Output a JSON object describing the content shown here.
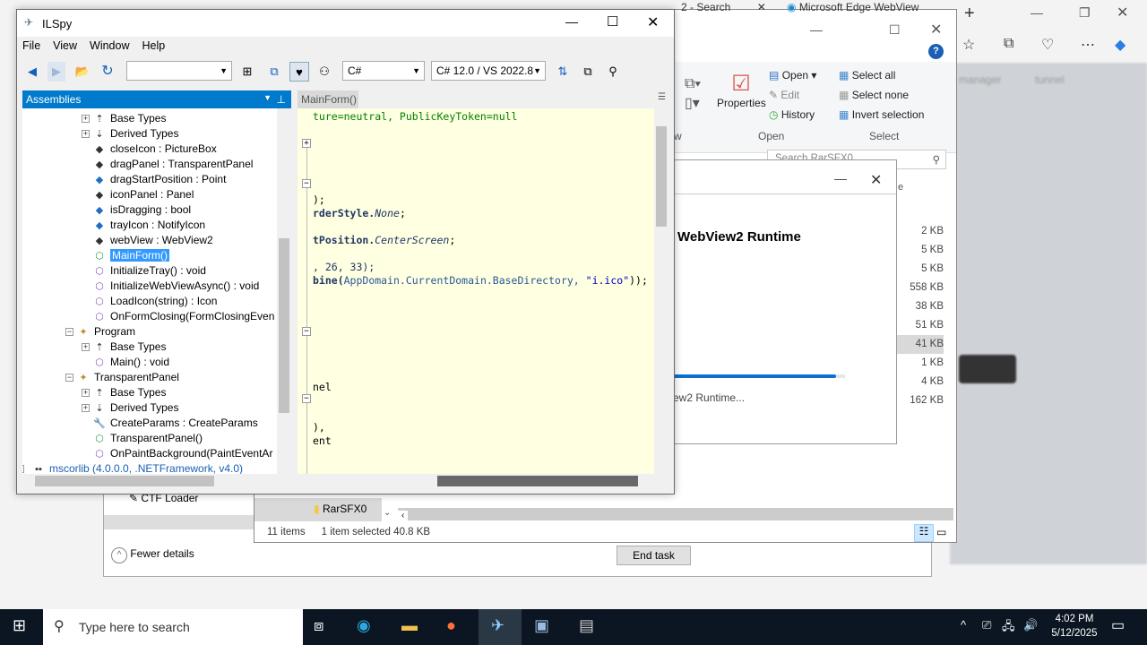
{
  "edge": {
    "tabs": [
      "2 - Search",
      "Microsoft Edge WebView"
    ],
    "new_tab": "+",
    "blurred": [
      "manager",
      "tunnel"
    ]
  },
  "explorer": {
    "ribbon": {
      "properties": "Properties",
      "open": "Open",
      "edit": "Edit",
      "history": "History",
      "select_all": "Select all",
      "select_none": "Select none",
      "invert_selection": "Invert selection",
      "group_view": "w",
      "group_open": "Open",
      "group_select": "Select"
    },
    "search_placeholder": "Search RarSFX0",
    "size_header": "e",
    "sizes": [
      "2 KB",
      "5 KB",
      "5 KB",
      "558 KB",
      "38 KB",
      "51 KB",
      "41 KB",
      "1 KB",
      "4 KB",
      "162 KB"
    ],
    "nav_folder": "RarSFX0",
    "status": {
      "items": "11 items",
      "selected": "1 item selected",
      "size": "40.8 KB"
    }
  },
  "task_manager": {
    "process": "CTF Loader",
    "fewer_details": "Fewer details",
    "end_task": "End task"
  },
  "installer": {
    "title": "WebView2 Runtime",
    "status": "ew2 Runtime...",
    "progress": 0.95
  },
  "ilspy": {
    "title": "ILSpy",
    "menu": [
      "File",
      "View",
      "Window",
      "Help"
    ],
    "language": "C#",
    "version": "C# 12.0 / VS 2022.8",
    "search_combo": "",
    "assemblies_label": "Assemblies",
    "tab": "MainForm()",
    "tree": [
      {
        "label": "Base Types",
        "icon": "base-types"
      },
      {
        "label": "Derived Types",
        "icon": "derived-types"
      },
      {
        "label": "closeIcon : PictureBox",
        "icon": "field"
      },
      {
        "label": "dragPanel : TransparentPanel",
        "icon": "field"
      },
      {
        "label": "dragStartPosition : Point",
        "icon": "field-struct"
      },
      {
        "label": "iconPanel : Panel",
        "icon": "field"
      },
      {
        "label": "isDragging : bool",
        "icon": "field-struct"
      },
      {
        "label": "trayIcon : NotifyIcon",
        "icon": "field-struct"
      },
      {
        "label": "webView : WebView2",
        "icon": "field"
      },
      {
        "label": "MainForm()",
        "icon": "constructor"
      },
      {
        "label": "InitializeTray() : void",
        "icon": "method"
      },
      {
        "label": "InitializeWebViewAsync() : void",
        "icon": "method"
      },
      {
        "label": "LoadIcon(string) : Icon",
        "icon": "method"
      },
      {
        "label": "OnFormClosing(FormClosingEven",
        "icon": "method"
      },
      {
        "label": "Program",
        "icon": "class"
      },
      {
        "label": "Base Types",
        "icon": "base-types"
      },
      {
        "label": "Main() : void",
        "icon": "method"
      },
      {
        "label": "TransparentPanel",
        "icon": "class"
      },
      {
        "label": "Base Types",
        "icon": "base-types"
      },
      {
        "label": "Derived Types",
        "icon": "derived-types"
      },
      {
        "label": "CreateParams : CreateParams",
        "icon": "property"
      },
      {
        "label": "TransparentPanel()",
        "icon": "constructor"
      },
      {
        "label": "OnPaintBackground(PaintEventAr",
        "icon": "method"
      },
      {
        "label": "mscorlib (4.0.0.0, .NETFramework, v4.0)",
        "icon": "assembly"
      }
    ],
    "code": {
      "l1": "ture=neutral, PublicKeyToken=null",
      "l2": ");",
      "l3a": "rderStyle.",
      "l3b": "None",
      "l3c": ";",
      "l4a": "tPosition.",
      "l4b": "CenterScreen",
      "l4c": ";",
      "l5": ", 26, 33);",
      "l6a": "bine(",
      "l6b": "AppDomain.CurrentDomain.BaseDirectory, ",
      "l6c": "\"i.ico\"",
      "l6d": "));",
      "l7": "nel",
      "l8": "),",
      "l9": "ent"
    }
  },
  "taskbar": {
    "search_placeholder": "Type here to search",
    "time": "4:02 PM",
    "date": "5/12/2025"
  }
}
